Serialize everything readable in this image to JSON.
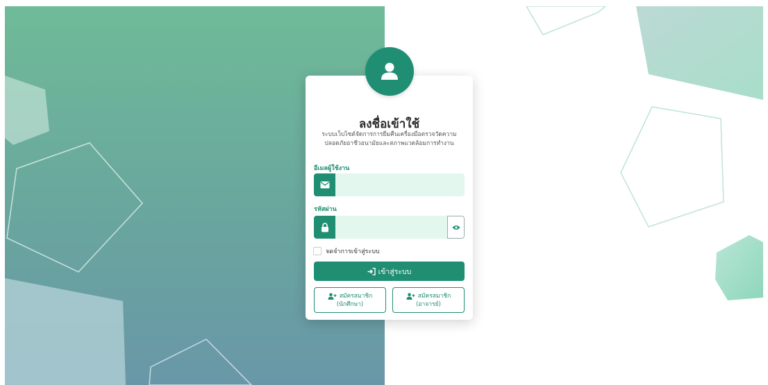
{
  "login": {
    "title": "ลงชื่อเข้าใช้",
    "subtitle_line1": "ระบบเว็บไซต์จัดการการยืมคืนเครื่องมือตรวจวัดความ",
    "subtitle_line2": "ปลอดภัยอาชีวอนามัยและสภาพแวดล้อมการทำงาน",
    "email_label": "อีเมลผู้ใช้งาน",
    "email_value": "",
    "password_label": "รหัสผ่าน",
    "password_value": "",
    "remember_label": "จดจำการเข้าสู่ระบบ",
    "remember_checked": false,
    "login_button": "เข้าสู่ระบบ",
    "register_student_line1": "สมัครสมาชิก",
    "register_student_line2": "(นักศึกษา)",
    "register_teacher_line1": "สมัครสมาชิก",
    "register_teacher_line2": "(อาจารย์)"
  },
  "icons": {
    "avatar": "user-icon",
    "email": "envelope-icon",
    "password": "lock-icon",
    "toggle": "eye-icon",
    "login": "sign-in-icon",
    "register": "user-plus-icon"
  },
  "colors": {
    "primary": "#1f8e72",
    "field_bg": "#e3f7ee",
    "bg_gradient_top": "#6fbb98",
    "bg_gradient_bottom": "#6997a8"
  }
}
